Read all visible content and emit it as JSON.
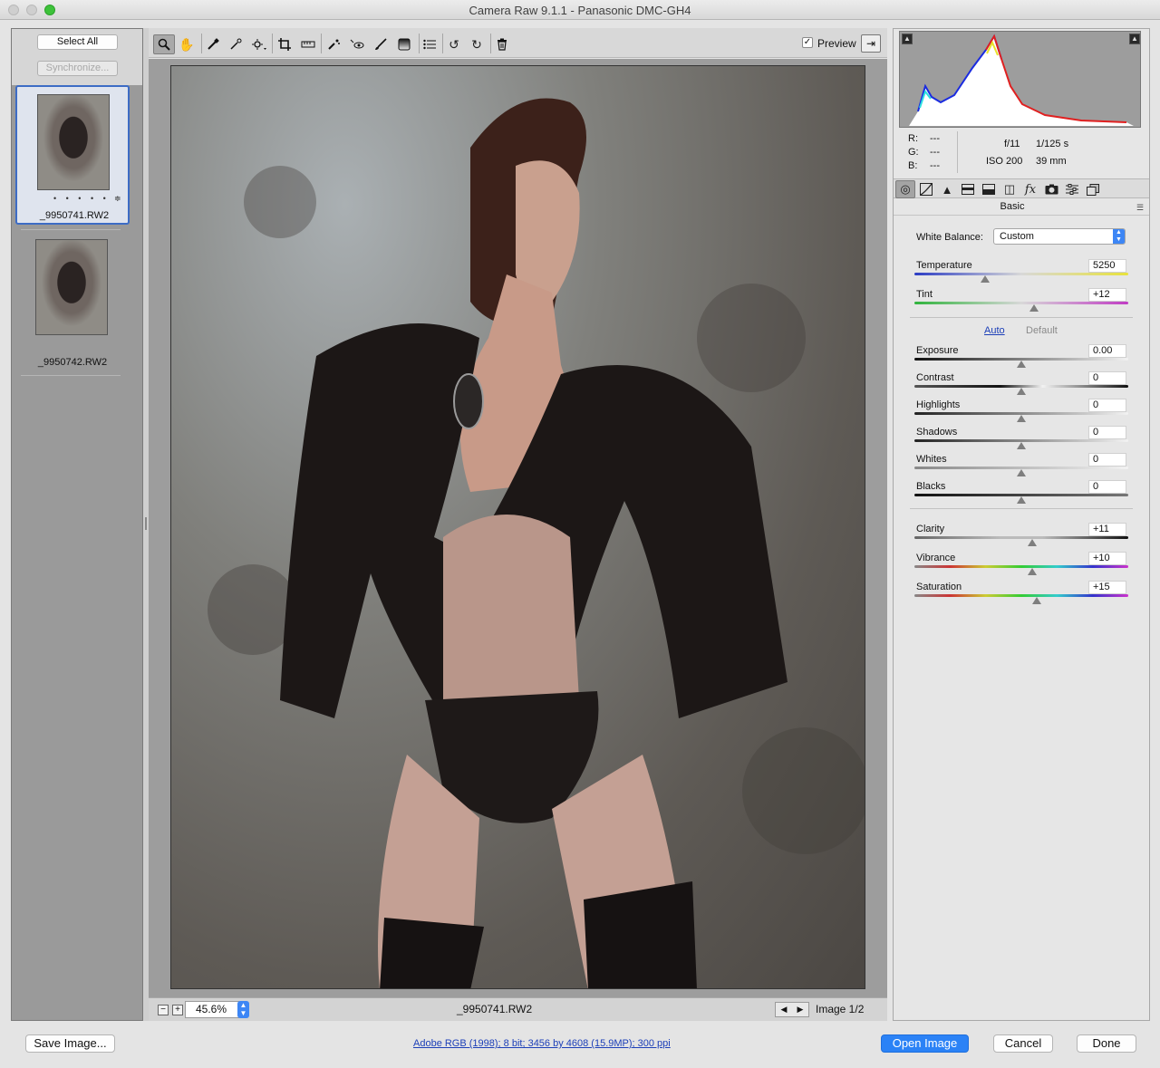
{
  "window": {
    "title": "Camera Raw 9.1.1  -  Panasonic DMC-GH4"
  },
  "filmstrip": {
    "select_all": "Select All",
    "synchronize": "Synchronize...",
    "items": [
      {
        "label": "_9950741.RW2",
        "rating_dots": "• • • • •"
      },
      {
        "label": "_9950742.RW2"
      }
    ]
  },
  "toolbar": {
    "preview_check": "✓",
    "preview_label": "Preview",
    "tools": [
      "zoom-tool-icon",
      "hand-tool-icon",
      "white-balance-tool-icon",
      "color-sampler-tool-icon",
      "targeted-adjustment-tool-icon",
      "crop-tool-icon",
      "straighten-tool-icon",
      "spot-removal-tool-icon",
      "red-eye-removal-tool-icon",
      "adjustment-brush-icon",
      "graduated-filter-icon",
      "radial-filter-icon",
      "preferences-icon",
      "rotate-ccw-icon",
      "rotate-cw-icon",
      "trash-icon"
    ]
  },
  "canvas": {
    "zoom": "45.6%",
    "filename": "_9950741.RW2",
    "image_count": "Image 1/2",
    "zoom_minus": "−",
    "zoom_plus": "+"
  },
  "info": {
    "r_label": "R:",
    "r_value": "---",
    "g_label": "G:",
    "g_value": "---",
    "b_label": "B:",
    "b_value": "---",
    "aperture": "f/11",
    "shutter": "1/125 s",
    "iso": "ISO 200",
    "focal": "39 mm"
  },
  "panel": {
    "section": "Basic",
    "white_balance_label": "White Balance:",
    "white_balance_value": "Custom",
    "auto": "Auto",
    "default": "Default",
    "sliders": [
      {
        "label": "Temperature",
        "value": "5250",
        "position": 0.33
      },
      {
        "label": "Tint",
        "value": "+12",
        "position": 0.56
      },
      {
        "label": "Exposure",
        "value": "0.00",
        "position": 0.5
      },
      {
        "label": "Contrast",
        "value": "0",
        "position": 0.5
      },
      {
        "label": "Highlights",
        "value": "0",
        "position": 0.5
      },
      {
        "label": "Shadows",
        "value": "0",
        "position": 0.5
      },
      {
        "label": "Whites",
        "value": "0",
        "position": 0.5
      },
      {
        "label": "Blacks",
        "value": "0",
        "position": 0.5
      },
      {
        "label": "Clarity",
        "value": "+11",
        "position": 0.55
      },
      {
        "label": "Vibrance",
        "value": "+10",
        "position": 0.55
      },
      {
        "label": "Saturation",
        "value": "+15",
        "position": 0.57
      }
    ]
  },
  "footer": {
    "save": "Save Image...",
    "workflow": "Adobe RGB (1998); 8 bit; 3456 by 4608 (15.9MP); 300 ppi",
    "open": "Open Image",
    "cancel": "Cancel",
    "done": "Done"
  },
  "colors": {
    "accent": "#2b82f6",
    "selection": "#3d6cc5",
    "link": "#1c3fb8"
  }
}
